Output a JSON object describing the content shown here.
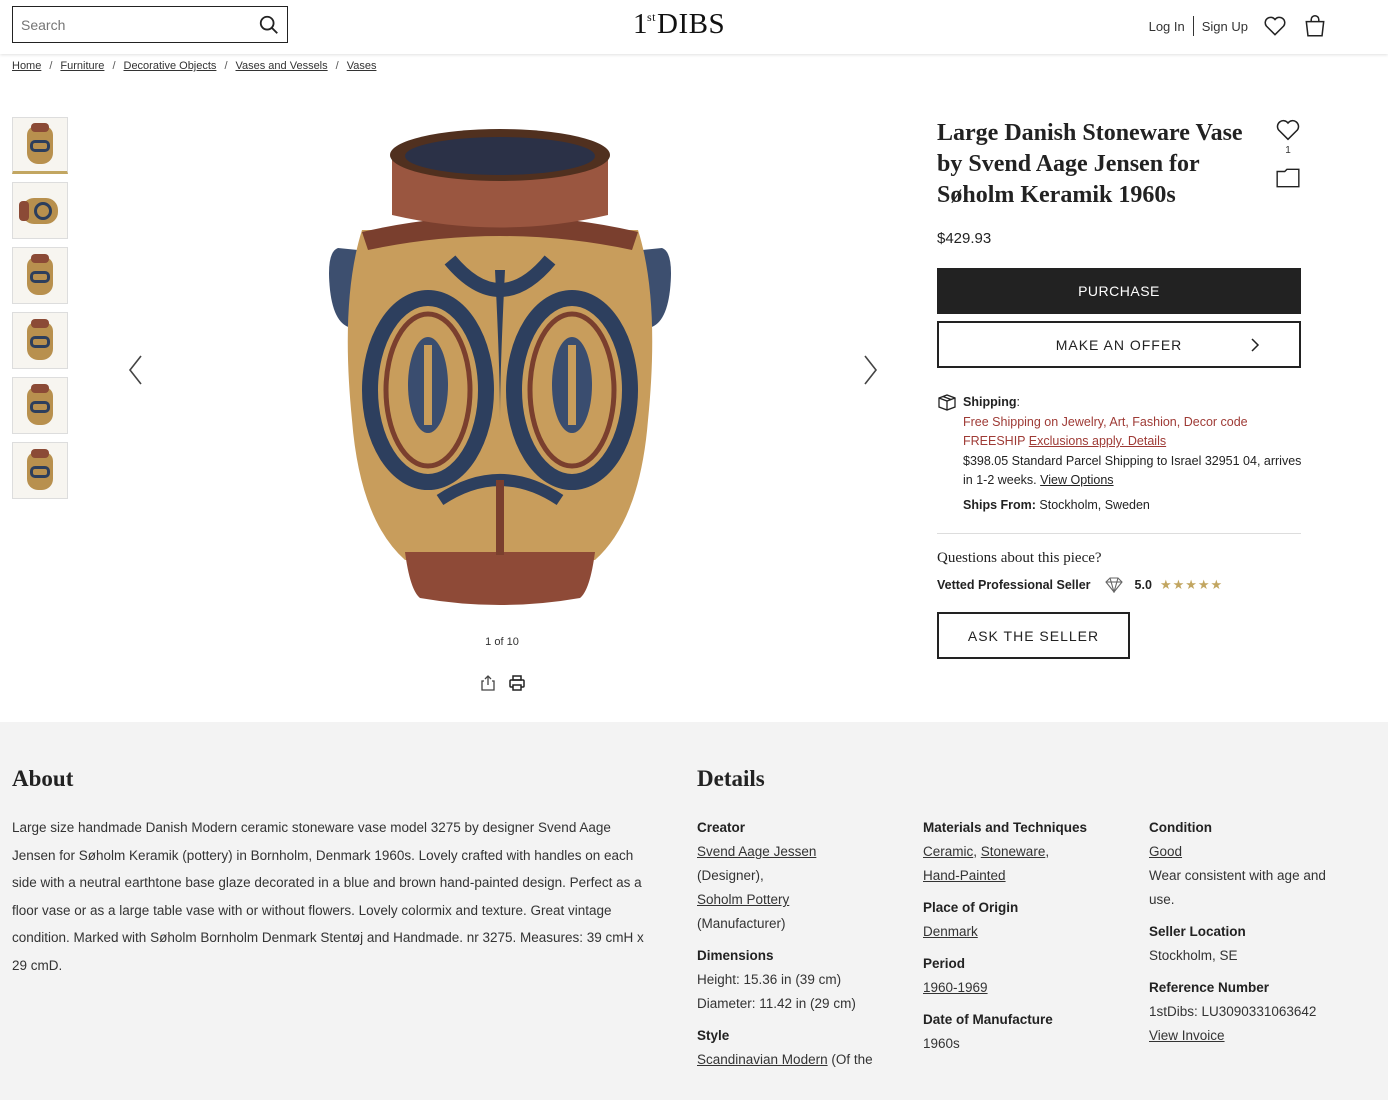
{
  "header": {
    "search_placeholder": "Search",
    "logo_main": "1",
    "logo_sup": "st",
    "logo_text": "DIBS",
    "login": "Log In",
    "signup": "Sign Up"
  },
  "breadcrumb": [
    "Home",
    "Furniture",
    "Decorative Objects",
    "Vases and Vessels",
    "Vases"
  ],
  "gallery": {
    "counter": "1 of 10",
    "thumb_count_visible": 6
  },
  "product": {
    "title": "Large Danish Stoneware Vase by Svend Aage Jensen for Søholm Keramik 1960s",
    "favorite_count": "1",
    "price": "$429.93",
    "purchase": "PURCHASE",
    "offer": "MAKE AN OFFER",
    "ask": "ASK THE SELLER"
  },
  "shipping": {
    "label": "Shipping",
    "colon": ":",
    "promo_line1": "Free Shipping on Jewelry, Art, Fashion, Decor code",
    "promo_code": "FREESHIP",
    "exclusions": "Exclusions apply. Details",
    "standard_line": "$398.05 Standard Parcel Shipping to Israel 32951 04, arrives in 1-2 weeks.",
    "view_options": "View Options",
    "ships_from_label": "Ships From:",
    "ships_from_value": "Stockholm, Sweden"
  },
  "seller": {
    "question": "Questions about this piece?",
    "vetted": "Vetted Professional Seller",
    "rating": "5.0",
    "stars": "★★★★★"
  },
  "about": {
    "heading": "About",
    "text": "Large size handmade Danish Modern ceramic stoneware vase model 3275 by designer Svend Aage Jensen for Søholm Keramik (pottery) in Bornholm, Denmark 1960s. Lovely crafted with handles on each side with a neutral earthtone base glaze decorated in a blue and brown hand-painted design. Perfect as a floor vase or as a large table vase with or without flowers. Lovely colormix and texture. Great vintage condition. Marked with Søholm Bornholm Denmark Stentøj and Handmade. nr 3275. Measures: 39 cmH x 29 cmD."
  },
  "details": {
    "heading": "Details",
    "creator_label": "Creator",
    "creator_name": "Svend Aage Jessen",
    "creator_role": "(Designer),",
    "manufacturer_name": "Soholm Pottery",
    "manufacturer_role": "(Manufacturer)",
    "dimensions_label": "Dimensions",
    "height": "Height: 15.36 in (39 cm)",
    "diameter": "Diameter: 11.42 in (29 cm)",
    "style_label": "Style",
    "style_value": "Scandinavian Modern",
    "style_suffix": " (Of the",
    "materials_label": "Materials and Techniques",
    "material_1": "Ceramic",
    "material_2": "Stoneware",
    "material_3": "Hand-Painted",
    "origin_label": "Place of Origin",
    "origin_value": "Denmark",
    "period_label": "Period",
    "period_value": "1960-1969",
    "dom_label": "Date of Manufacture",
    "dom_value": "1960s",
    "condition_label": "Condition",
    "condition_value": "Good",
    "condition_note": "Wear consistent with age and use.",
    "location_label": "Seller Location",
    "location_value": "Stockholm, SE",
    "ref_label": "Reference Number",
    "ref_value": "1stDibs: LU3090331063642",
    "invoice": "View Invoice"
  },
  "colors": {
    "accent_gold": "#c2a661",
    "promo_red": "#9e3a35",
    "button_dark": "#222222"
  }
}
